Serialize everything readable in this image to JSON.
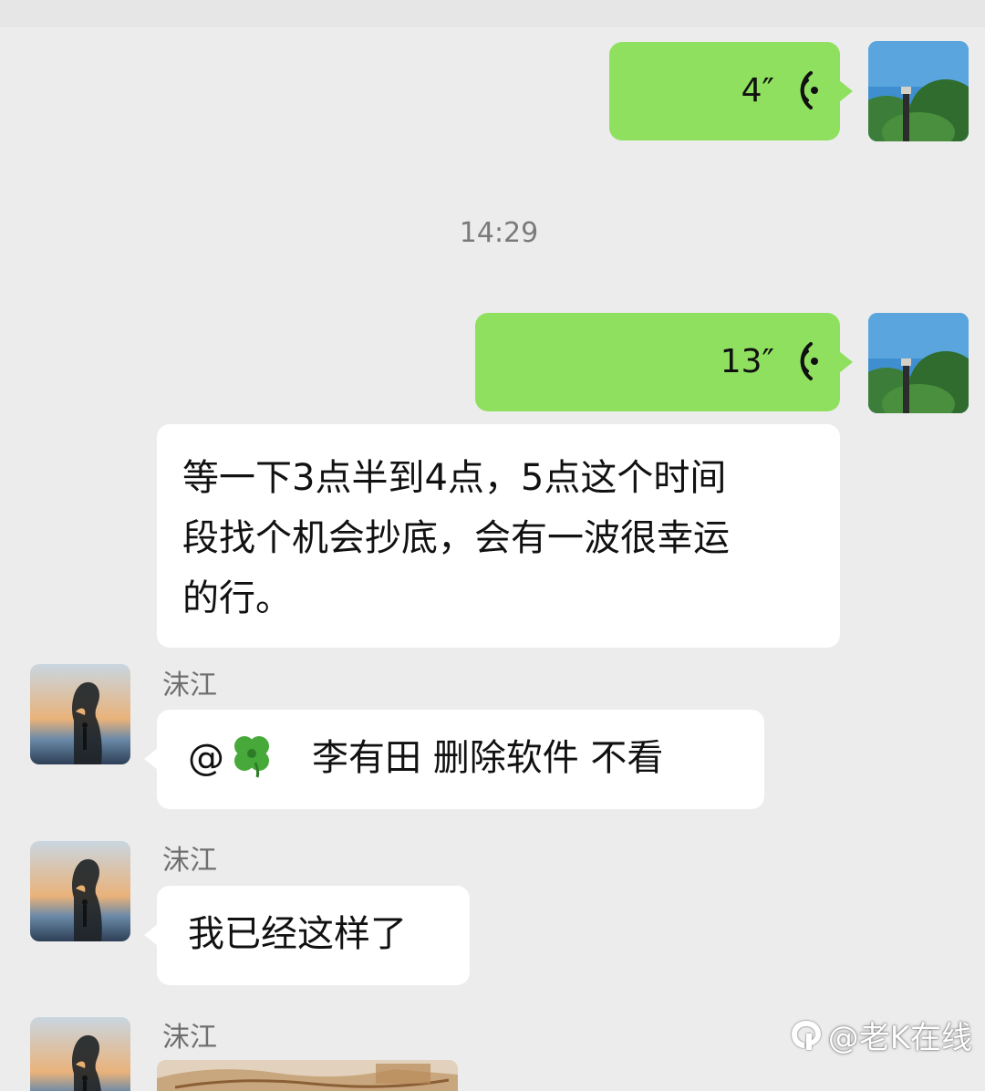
{
  "chat": {
    "messages": [
      {
        "kind": "voice",
        "side": "right",
        "duration": "4″",
        "avatar_icon": "landscape-tree-avatar"
      },
      {
        "kind": "timestamp",
        "text": "14:29"
      },
      {
        "kind": "voice",
        "side": "right",
        "duration": "13″",
        "avatar_icon": "landscape-tree-avatar"
      },
      {
        "kind": "text",
        "side": "left",
        "lines": [
          "等一下3点半到4点，5点这个时间",
          "段找个机会抄底，会有一波很幸运",
          "的行。"
        ]
      },
      {
        "kind": "text",
        "side": "left",
        "sender": "沫江",
        "mention_prefix": "@",
        "mention_icon": "four-leaf-clover-emoji",
        "text": "李有田  删除软件 不看",
        "avatar_icon": "silhouette-sunset-avatar"
      },
      {
        "kind": "text",
        "side": "left",
        "sender": "沫江",
        "text": "我已经这样了",
        "avatar_icon": "silhouette-sunset-avatar"
      },
      {
        "kind": "image",
        "side": "left",
        "sender": "沫江",
        "avatar_icon": "silhouette-sunset-avatar"
      }
    ]
  },
  "watermark": {
    "text": "@老K在线",
    "icon": "platform-logo-icon"
  },
  "colors": {
    "background": "#ececec",
    "sent_bubble": "#8fe05f",
    "received_bubble": "#ffffff",
    "name_text": "#6f6f6f",
    "timestamp_text": "#7a7a7a"
  }
}
